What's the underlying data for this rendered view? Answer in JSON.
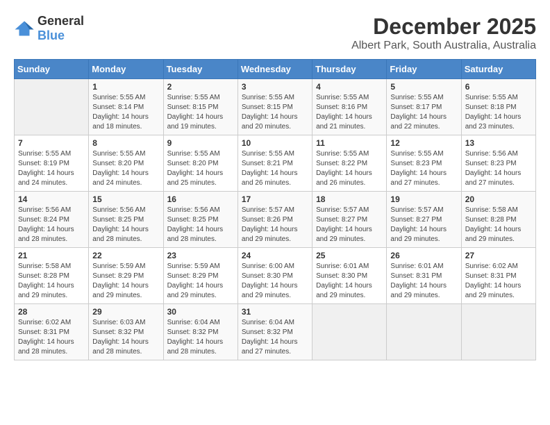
{
  "header": {
    "logo_general": "General",
    "logo_blue": "Blue",
    "title": "December 2025",
    "location": "Albert Park, South Australia, Australia"
  },
  "calendar": {
    "days_of_week": [
      "Sunday",
      "Monday",
      "Tuesday",
      "Wednesday",
      "Thursday",
      "Friday",
      "Saturday"
    ],
    "weeks": [
      [
        {
          "day": "",
          "info": ""
        },
        {
          "day": "1",
          "info": "Sunrise: 5:55 AM\nSunset: 8:14 PM\nDaylight: 14 hours\nand 18 minutes."
        },
        {
          "day": "2",
          "info": "Sunrise: 5:55 AM\nSunset: 8:15 PM\nDaylight: 14 hours\nand 19 minutes."
        },
        {
          "day": "3",
          "info": "Sunrise: 5:55 AM\nSunset: 8:15 PM\nDaylight: 14 hours\nand 20 minutes."
        },
        {
          "day": "4",
          "info": "Sunrise: 5:55 AM\nSunset: 8:16 PM\nDaylight: 14 hours\nand 21 minutes."
        },
        {
          "day": "5",
          "info": "Sunrise: 5:55 AM\nSunset: 8:17 PM\nDaylight: 14 hours\nand 22 minutes."
        },
        {
          "day": "6",
          "info": "Sunrise: 5:55 AM\nSunset: 8:18 PM\nDaylight: 14 hours\nand 23 minutes."
        }
      ],
      [
        {
          "day": "7",
          "info": "Sunrise: 5:55 AM\nSunset: 8:19 PM\nDaylight: 14 hours\nand 24 minutes."
        },
        {
          "day": "8",
          "info": "Sunrise: 5:55 AM\nSunset: 8:20 PM\nDaylight: 14 hours\nand 24 minutes."
        },
        {
          "day": "9",
          "info": "Sunrise: 5:55 AM\nSunset: 8:20 PM\nDaylight: 14 hours\nand 25 minutes."
        },
        {
          "day": "10",
          "info": "Sunrise: 5:55 AM\nSunset: 8:21 PM\nDaylight: 14 hours\nand 26 minutes."
        },
        {
          "day": "11",
          "info": "Sunrise: 5:55 AM\nSunset: 8:22 PM\nDaylight: 14 hours\nand 26 minutes."
        },
        {
          "day": "12",
          "info": "Sunrise: 5:55 AM\nSunset: 8:23 PM\nDaylight: 14 hours\nand 27 minutes."
        },
        {
          "day": "13",
          "info": "Sunrise: 5:56 AM\nSunset: 8:23 PM\nDaylight: 14 hours\nand 27 minutes."
        }
      ],
      [
        {
          "day": "14",
          "info": "Sunrise: 5:56 AM\nSunset: 8:24 PM\nDaylight: 14 hours\nand 28 minutes."
        },
        {
          "day": "15",
          "info": "Sunrise: 5:56 AM\nSunset: 8:25 PM\nDaylight: 14 hours\nand 28 minutes."
        },
        {
          "day": "16",
          "info": "Sunrise: 5:56 AM\nSunset: 8:25 PM\nDaylight: 14 hours\nand 28 minutes."
        },
        {
          "day": "17",
          "info": "Sunrise: 5:57 AM\nSunset: 8:26 PM\nDaylight: 14 hours\nand 29 minutes."
        },
        {
          "day": "18",
          "info": "Sunrise: 5:57 AM\nSunset: 8:27 PM\nDaylight: 14 hours\nand 29 minutes."
        },
        {
          "day": "19",
          "info": "Sunrise: 5:57 AM\nSunset: 8:27 PM\nDaylight: 14 hours\nand 29 minutes."
        },
        {
          "day": "20",
          "info": "Sunrise: 5:58 AM\nSunset: 8:28 PM\nDaylight: 14 hours\nand 29 minutes."
        }
      ],
      [
        {
          "day": "21",
          "info": "Sunrise: 5:58 AM\nSunset: 8:28 PM\nDaylight: 14 hours\nand 29 minutes."
        },
        {
          "day": "22",
          "info": "Sunrise: 5:59 AM\nSunset: 8:29 PM\nDaylight: 14 hours\nand 29 minutes."
        },
        {
          "day": "23",
          "info": "Sunrise: 5:59 AM\nSunset: 8:29 PM\nDaylight: 14 hours\nand 29 minutes."
        },
        {
          "day": "24",
          "info": "Sunrise: 6:00 AM\nSunset: 8:30 PM\nDaylight: 14 hours\nand 29 minutes."
        },
        {
          "day": "25",
          "info": "Sunrise: 6:01 AM\nSunset: 8:30 PM\nDaylight: 14 hours\nand 29 minutes."
        },
        {
          "day": "26",
          "info": "Sunrise: 6:01 AM\nSunset: 8:31 PM\nDaylight: 14 hours\nand 29 minutes."
        },
        {
          "day": "27",
          "info": "Sunrise: 6:02 AM\nSunset: 8:31 PM\nDaylight: 14 hours\nand 29 minutes."
        }
      ],
      [
        {
          "day": "28",
          "info": "Sunrise: 6:02 AM\nSunset: 8:31 PM\nDaylight: 14 hours\nand 28 minutes."
        },
        {
          "day": "29",
          "info": "Sunrise: 6:03 AM\nSunset: 8:32 PM\nDaylight: 14 hours\nand 28 minutes."
        },
        {
          "day": "30",
          "info": "Sunrise: 6:04 AM\nSunset: 8:32 PM\nDaylight: 14 hours\nand 28 minutes."
        },
        {
          "day": "31",
          "info": "Sunrise: 6:04 AM\nSunset: 8:32 PM\nDaylight: 14 hours\nand 27 minutes."
        },
        {
          "day": "",
          "info": ""
        },
        {
          "day": "",
          "info": ""
        },
        {
          "day": "",
          "info": ""
        }
      ]
    ]
  }
}
